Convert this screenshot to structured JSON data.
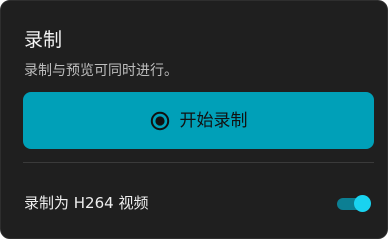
{
  "panel": {
    "title": "录制",
    "subtitle": "录制与预览可同时进行。"
  },
  "record_button": {
    "label": "开始录制",
    "icon": "record-icon"
  },
  "h264_toggle": {
    "label": "录制为 H264 视频",
    "on": true
  },
  "colors": {
    "panel_background": "#1f1f1f",
    "accent": "#00a0b8",
    "toggle_on": "#19d3f0"
  }
}
